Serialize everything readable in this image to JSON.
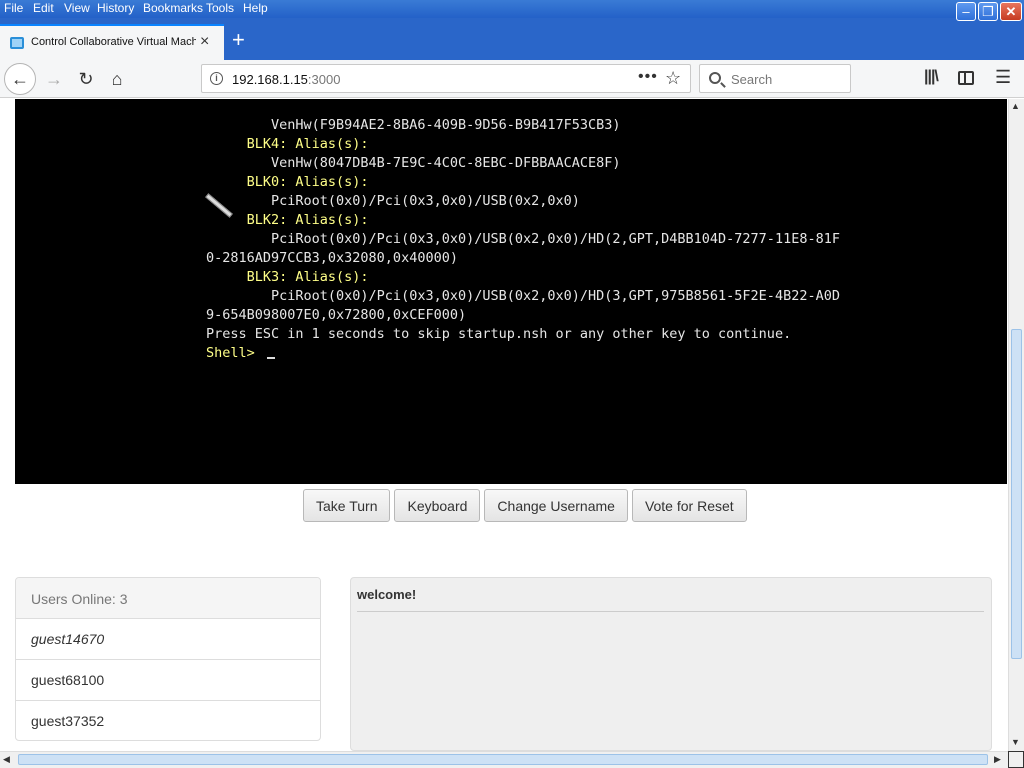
{
  "menubar": {
    "items": [
      "File",
      "Edit",
      "View",
      "History",
      "Bookmarks",
      "Tools",
      "Help"
    ]
  },
  "tab": {
    "title": "Control Collaborative Virtual Machine",
    "close": "×",
    "new_tab": "+"
  },
  "navbar": {
    "url_host": "192.168.1.15",
    "url_port": ":3000",
    "page_actions": "•••",
    "search_placeholder": "Search"
  },
  "console": {
    "lines": [
      "        VenHw(F9B94AE2-8BA6-409B-9D56-B9B417F53CB3)",
      "     BLK4: Alias(s):",
      "        VenHw(8047DB4B-7E9C-4C0C-8EBC-DFBBAACACE8F)",
      "     BLK0: Alias(s):",
      "        PciRoot(0x0)/Pci(0x3,0x0)/USB(0x2,0x0)",
      "     BLK2: Alias(s):",
      "        PciRoot(0x0)/Pci(0x3,0x0)/USB(0x2,0x0)/HD(2,GPT,D4BB104D-7277-11E8-81F",
      "0-2816AD97CCB3,0x32080,0x40000)",
      "     BLK3: Alias(s):",
      "        PciRoot(0x0)/Pci(0x3,0x0)/USB(0x2,0x0)/HD(3,GPT,975B8561-5F2E-4B22-A0D",
      "9-654B098007E0,0x72800,0xCEF000)",
      "Press ESC in 1 seconds to skip startup.nsh or any other key to continue.",
      "Shell> "
    ]
  },
  "controls": {
    "take_turn": "Take Turn",
    "keyboard": "Keyboard",
    "change_username": "Change Username",
    "vote_reset": "Vote for Reset"
  },
  "users": {
    "header": "Users Online: 3",
    "list": [
      "guest14670",
      "guest68100",
      "guest37352"
    ]
  },
  "chat": {
    "messages": [
      "welcome!"
    ]
  },
  "colors": {
    "titlebar": "#2a66c9",
    "console_bg": "#000000",
    "console_highlight": "#ffff88",
    "tab_accent": "#0a84ff"
  }
}
